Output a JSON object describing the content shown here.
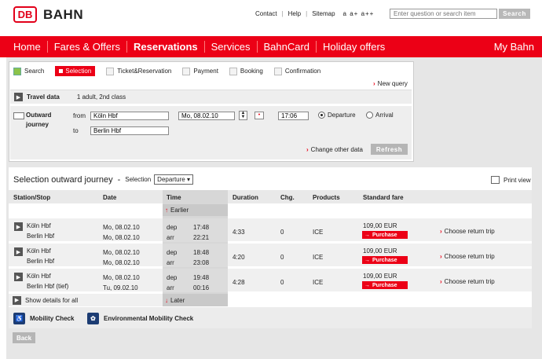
{
  "header": {
    "logo_mark": "DB",
    "logo_text": "BAHN",
    "links": [
      "Contact",
      "Help",
      "Sitemap"
    ],
    "font_sizes": "a  a+  a++",
    "search_placeholder": "Enter question or search item",
    "search_button": "Search"
  },
  "nav": {
    "items": [
      "Home",
      "Fares & Offers",
      "Reservations",
      "Services",
      "BahnCard",
      "Holiday offers"
    ],
    "my": "My Bahn"
  },
  "steps": [
    "Search",
    "Selection",
    "Ticket&Reservation",
    "Payment",
    "Booking",
    "Confirmation"
  ],
  "new_query": "New query",
  "travel_data": {
    "label": "Travel data",
    "value": "1 adult, 2nd class"
  },
  "outward": {
    "label_line1": "Outward",
    "label_line2": "journey",
    "from_label": "from",
    "to_label": "to",
    "from_value": "Köln Hbf",
    "to_value": "Berlin Hbf",
    "date_value": "Mo, 08.02.10",
    "time_value": "17:06",
    "departure": "Departure",
    "arrival": "Arrival",
    "change_other": "Change other data",
    "refresh": "Refresh"
  },
  "results": {
    "title": "Selection outward journey",
    "dash": "-",
    "selection_label": "Selection",
    "selection_value": "Departure",
    "print": "Print view",
    "headers": {
      "station": "Station/Stop",
      "date": "Date",
      "time": "Time",
      "duration": "Duration",
      "changes": "Chg.",
      "products": "Products",
      "fare": "Standard fare"
    },
    "earlier": "Earlier",
    "later": "Later",
    "show_details": "Show details for all",
    "connections": [
      {
        "from": "Köln Hbf",
        "to": "Berlin Hbf",
        "date_dep": "Mo, 08.02.10",
        "date_arr": "Mo, 08.02.10",
        "dep_label": "dep",
        "arr_label": "arr",
        "dep": "17:48",
        "arr": "22:21",
        "duration": "4:33",
        "changes": "0",
        "product": "ICE",
        "fare": "109,00 EUR",
        "purchase": "Purchase",
        "return": "Choose return trip"
      },
      {
        "from": "Köln Hbf",
        "to": "Berlin Hbf",
        "date_dep": "Mo, 08.02.10",
        "date_arr": "Mo, 08.02.10",
        "dep_label": "dep",
        "arr_label": "arr",
        "dep": "18:48",
        "arr": "23:08",
        "duration": "4:20",
        "changes": "0",
        "product": "ICE",
        "fare": "109,00 EUR",
        "purchase": "Purchase",
        "return": "Choose return trip"
      },
      {
        "from": "Köln Hbf",
        "to": "Berlin Hbf (tief)",
        "date_dep": "Mo, 08.02.10",
        "date_arr": "Tu, 09.02.10",
        "dep_label": "dep",
        "arr_label": "arr",
        "dep": "19:48",
        "arr": "00:16",
        "duration": "4:28",
        "changes": "0",
        "product": "ICE",
        "fare": "109,00 EUR",
        "purchase": "Purchase",
        "return": "Choose return trip"
      }
    ]
  },
  "footer": {
    "mobility": "Mobility Check",
    "environmental": "Environmental Mobility Check",
    "back": "Back"
  },
  "colors": {
    "brand": "#ec0016",
    "background": "#e6e6e6"
  }
}
